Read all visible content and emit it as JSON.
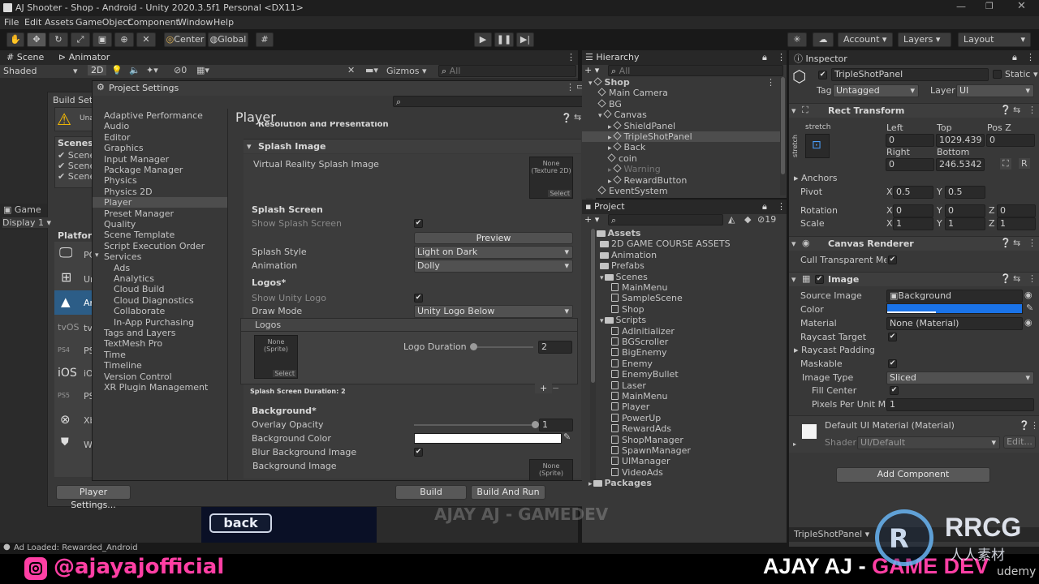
{
  "window": {
    "title": "AJ Shooter - Shop - Android - Unity 2020.3.5f1 Personal <DX11>"
  },
  "menu": [
    "File",
    "Edit",
    "Assets",
    "GameObject",
    "Component",
    "Window",
    "Help"
  ],
  "toolbar": {
    "pivot": "Center",
    "space": "Global",
    "account": "Account",
    "layers": "Layers",
    "layout": "Layout"
  },
  "scene_panel": {
    "tabs": [
      "Scene",
      "Animator"
    ],
    "shading": "Shaded",
    "mode2d": "2D",
    "gizmos": "Gizmos",
    "search_placeholder": "All",
    "hidden_count": "0"
  },
  "build_settings": {
    "title": "Build Setti",
    "warning": "Una",
    "scenes_label": "Scenes I",
    "scenes": [
      "Scene",
      "Scene",
      "Scene"
    ],
    "platform_label": "Platform",
    "platforms": [
      "PC",
      "Ur",
      "Ar",
      "tv",
      "PS",
      "iO",
      "PS",
      "Xb",
      "W"
    ],
    "platform_icons": [
      "monitor-icon",
      "windows-icon",
      "android-icon",
      "tvos-icon",
      "ps4-icon",
      "ios-icon",
      "ps5-icon",
      "xbox-icon",
      "html5-icon"
    ],
    "player_settings_button": "Player Settings...",
    "build_button": "Build",
    "build_and_run_button": "Build And Run"
  },
  "game_panel": {
    "tab": "Game",
    "display": "Display 1",
    "back_button": "back"
  },
  "project_settings": {
    "title": "Project Settings",
    "search_placeholder": "",
    "nav": [
      {
        "label": "Adaptive Performance",
        "indent": 0
      },
      {
        "label": "Audio",
        "indent": 0
      },
      {
        "label": "Editor",
        "indent": 0
      },
      {
        "label": "Graphics",
        "indent": 0
      },
      {
        "label": "Input Manager",
        "indent": 0
      },
      {
        "label": "Package Manager",
        "indent": 0
      },
      {
        "label": "Physics",
        "indent": 0
      },
      {
        "label": "Physics 2D",
        "indent": 0
      },
      {
        "label": "Player",
        "indent": 0,
        "selected": true
      },
      {
        "label": "Preset Manager",
        "indent": 0
      },
      {
        "label": "Quality",
        "indent": 0
      },
      {
        "label": "Scene Template",
        "indent": 0
      },
      {
        "label": "Script Execution Order",
        "indent": 0
      },
      {
        "label": "Services",
        "indent": 0,
        "expanded": true
      },
      {
        "label": "Ads",
        "indent": 1
      },
      {
        "label": "Analytics",
        "indent": 1
      },
      {
        "label": "Cloud Build",
        "indent": 1
      },
      {
        "label": "Cloud Diagnostics",
        "indent": 1
      },
      {
        "label": "Collaborate",
        "indent": 1
      },
      {
        "label": "In-App Purchasing",
        "indent": 1
      },
      {
        "label": "Tags and Layers",
        "indent": 0
      },
      {
        "label": "TextMesh Pro",
        "indent": 0
      },
      {
        "label": "Time",
        "indent": 0
      },
      {
        "label": "Timeline",
        "indent": 0
      },
      {
        "label": "Version Control",
        "indent": 0
      },
      {
        "label": "XR Plugin Management",
        "indent": 0
      }
    ],
    "player": {
      "heading": "Player",
      "resolution_section": "Resolution and Presentation",
      "splash_image_section": "Splash Image",
      "vr_splash_label": "Virtual Reality Splash Image",
      "vr_splash_none": "None",
      "vr_splash_type": "(Texture 2D)",
      "select": "Select",
      "splash_screen_heading": "Splash Screen",
      "show_splash_label": "Show Splash Screen",
      "show_splash_checked": true,
      "preview_button": "Preview",
      "splash_style_label": "Splash Style",
      "splash_style_value": "Light on Dark",
      "animation_label": "Animation",
      "animation_value": "Dolly",
      "logos_heading": "Logos*",
      "show_unity_logo_label": "Show Unity Logo",
      "show_unity_logo_checked": true,
      "draw_mode_label": "Draw Mode",
      "draw_mode_value": "Unity Logo Below",
      "logos_list_header": "Logos",
      "logo_none": "None",
      "logo_type": "(Sprite)",
      "logo_duration_label": "Logo Duration",
      "logo_duration_value": "2",
      "logo_duration_fraction": 0.0,
      "splash_duration_text": "Splash Screen Duration: 2",
      "background_heading": "Background*",
      "overlay_opacity_label": "Overlay Opacity",
      "overlay_opacity_value": "1",
      "overlay_opacity_fraction": 1.0,
      "background_color_label": "Background Color",
      "background_color": "#ffffff",
      "blur_bg_label": "Blur Background Image",
      "blur_bg_checked": true,
      "background_image_label": "Background Image",
      "background_image_none": "None",
      "background_image_type": "(Sprite)"
    }
  },
  "hierarchy": {
    "tab": "Hierarchy",
    "search_placeholder": "All",
    "items": [
      {
        "label": "Shop",
        "indent": 0,
        "kind": "scene"
      },
      {
        "label": "Main Camera",
        "indent": 1
      },
      {
        "label": "BG",
        "indent": 1
      },
      {
        "label": "Canvas",
        "indent": 1,
        "expanded": true
      },
      {
        "label": "ShieldPanel",
        "indent": 2,
        "arrow": true
      },
      {
        "label": "TripleShotPanel",
        "indent": 2,
        "arrow": true,
        "selected": true
      },
      {
        "label": "Back",
        "indent": 2,
        "arrow": true
      },
      {
        "label": "coin",
        "indent": 2
      },
      {
        "label": "Warning",
        "indent": 2,
        "arrow": true,
        "disabled": true
      },
      {
        "label": "RewardButton",
        "indent": 2,
        "arrow": true
      },
      {
        "label": "EventSystem",
        "indent": 1
      }
    ]
  },
  "project": {
    "tab": "Project",
    "hidden_count": "19",
    "tree": [
      {
        "label": "Assets",
        "indent": 0,
        "folder": true,
        "bold": true
      },
      {
        "label": "2D GAME COURSE ASSETS",
        "indent": 1,
        "folder": true
      },
      {
        "label": "Animation",
        "indent": 1,
        "folder": true
      },
      {
        "label": "Prefabs",
        "indent": 1,
        "folder": true
      },
      {
        "label": "Scenes",
        "indent": 1,
        "folder": true
      },
      {
        "label": "MainMenu",
        "indent": 2
      },
      {
        "label": "SampleScene",
        "indent": 2
      },
      {
        "label": "Shop",
        "indent": 2
      },
      {
        "label": "Scripts",
        "indent": 1,
        "folder": true
      },
      {
        "label": "AdInitializer",
        "indent": 2
      },
      {
        "label": "BGScroller",
        "indent": 2
      },
      {
        "label": "BigEnemy",
        "indent": 2
      },
      {
        "label": "Enemy",
        "indent": 2
      },
      {
        "label": "EnemyBullet",
        "indent": 2
      },
      {
        "label": "Laser",
        "indent": 2
      },
      {
        "label": "MainMenu",
        "indent": 2
      },
      {
        "label": "Player",
        "indent": 2
      },
      {
        "label": "PowerUp",
        "indent": 2
      },
      {
        "label": "RewardAds",
        "indent": 2
      },
      {
        "label": "ShopManager",
        "indent": 2
      },
      {
        "label": "SpawnManager",
        "indent": 2
      },
      {
        "label": "UIManager",
        "indent": 2
      },
      {
        "label": "VideoAds",
        "indent": 2
      },
      {
        "label": "Packages",
        "indent": 0,
        "folder": true,
        "bold": true
      }
    ]
  },
  "inspector": {
    "tab": "Inspector",
    "object_name": "TripleShotPanel",
    "static_label": "Static",
    "tag_label": "Tag",
    "tag_value": "Untagged",
    "layer_label": "Layer",
    "layer_value": "UI",
    "rect_transform": {
      "title": "Rect Transform",
      "anchor_preset": "stretch",
      "left_label": "Left",
      "left": "0",
      "top_label": "Top",
      "top": "1029.439",
      "posz_label": "Pos Z",
      "posz": "0",
      "right_label": "Right",
      "right": "0",
      "bottom_label": "Bottom",
      "bottom": "246.5342",
      "anchors_label": "Anchors",
      "pivot_label": "Pivot",
      "pivot_x": "0.5",
      "pivot_y": "0.5",
      "rotation_label": "Rotation",
      "rot_x": "0",
      "rot_y": "0",
      "rot_z": "0",
      "scale_label": "Scale",
      "scale_x": "1",
      "scale_y": "1",
      "scale_z": "1",
      "x": "X",
      "y": "Y",
      "z": "Z"
    },
    "canvas_renderer": {
      "title": "Canvas Renderer",
      "cull_label": "Cull Transparent Mesh",
      "cull_checked": true
    },
    "image": {
      "title": "Image",
      "source_label": "Source Image",
      "source_value": "Background",
      "color_label": "Color",
      "color": "#1a73e8",
      "material_label": "Material",
      "material_value": "None (Material)",
      "raycast_target_label": "Raycast Target",
      "raycast_target_checked": true,
      "raycast_padding_label": "Raycast Padding",
      "maskable_label": "Maskable",
      "maskable_checked": true,
      "image_type_label": "Image Type",
      "image_type_value": "Sliced",
      "fill_center_label": "Fill Center",
      "fill_center_checked": true,
      "ppu_label": "Pixels Per Unit Mult",
      "ppu_value": "1"
    },
    "material": {
      "title": "Default UI Material (Material)",
      "shader_label": "Shader",
      "shader_value": "UI/Default",
      "edit_button": "Edit..."
    },
    "add_component": "Add Component",
    "footer_object": "TripleShotPanel"
  },
  "status_bar": {
    "message": "Ad Loaded: Rewarded_Android"
  },
  "overlay": {
    "instagram_handle": "@ajayajofficial",
    "watermark": "AJAY AJ - GAMEDEV",
    "brand_left": "AJAY AJ - ",
    "brand_right": "GAME DEV",
    "rrcg": "RRCG",
    "rrcg_sub": "人人素材",
    "udemy": "udemy",
    "accent_pink": "#ff3fa4"
  }
}
